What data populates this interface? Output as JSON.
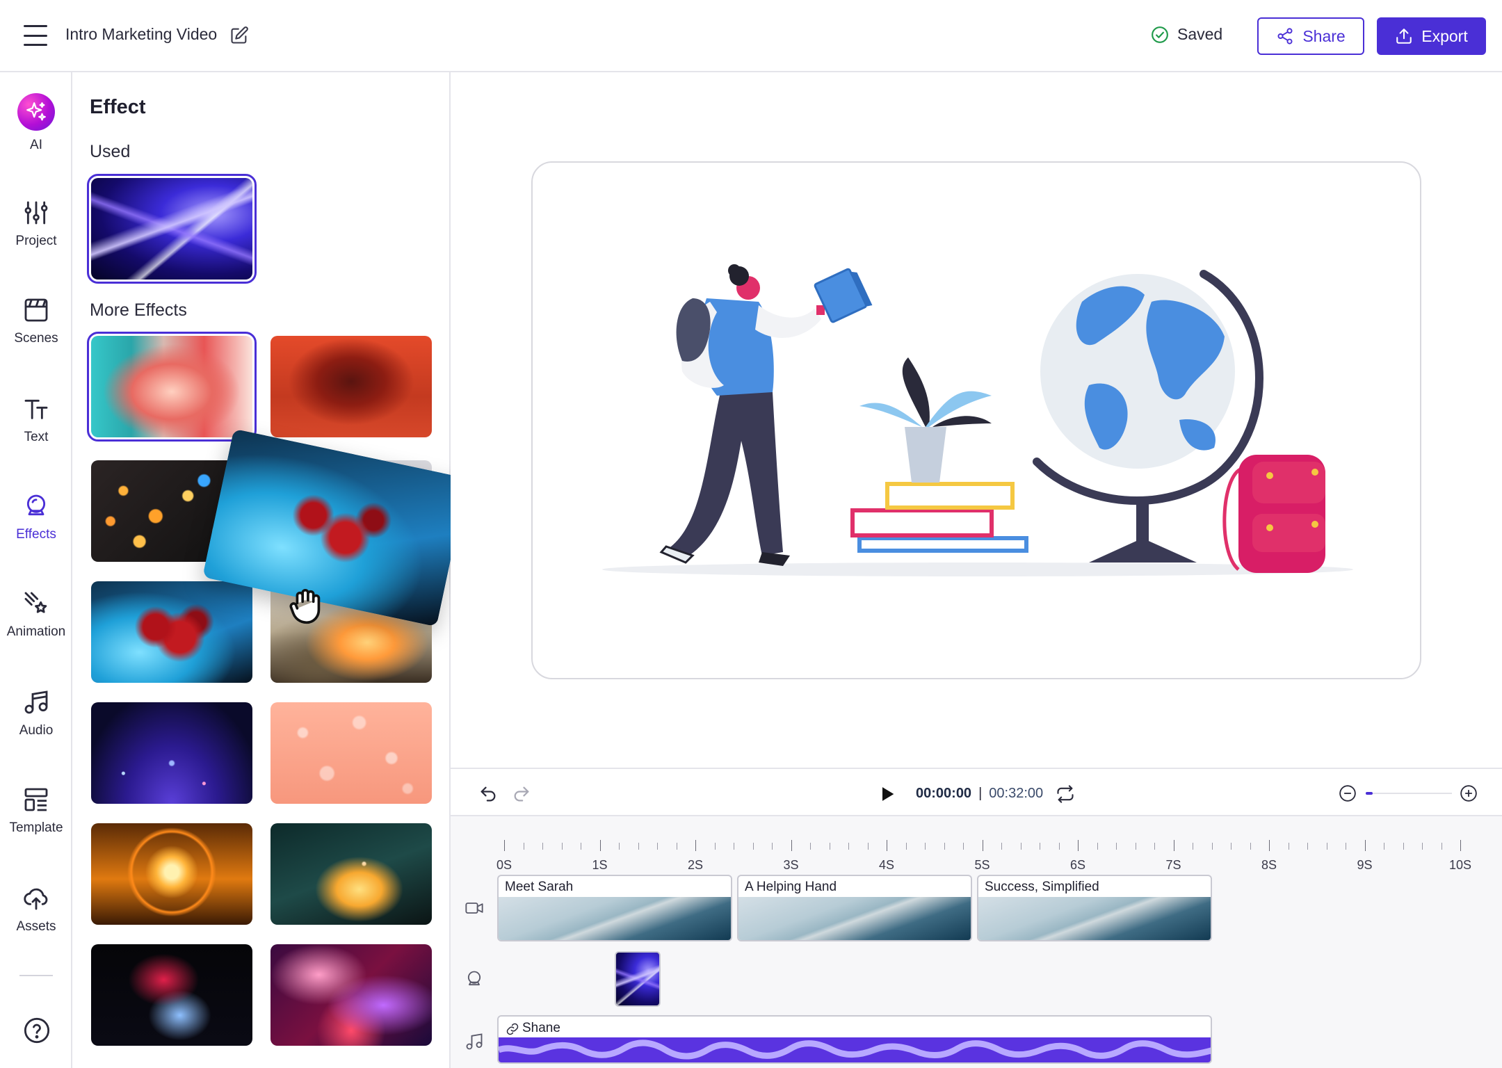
{
  "app": {
    "project_title": "Intro Marketing Video",
    "save_status": "Saved",
    "share_label": "Share",
    "export_label": "Export",
    "accent_color": "#4a2fd6"
  },
  "rail": {
    "items": [
      {
        "label": "AI",
        "icon": "ai-sparkle-icon"
      },
      {
        "label": "Project",
        "icon": "sliders-icon"
      },
      {
        "label": "Scenes",
        "icon": "clapperboard-icon"
      },
      {
        "label": "Text",
        "icon": "text-icon"
      },
      {
        "label": "Effects",
        "icon": "effects-icon",
        "active": true
      },
      {
        "label": "Animation",
        "icon": "animation-icon"
      },
      {
        "label": "Audio",
        "icon": "music-note-icon"
      },
      {
        "label": "Template",
        "icon": "template-icon"
      },
      {
        "label": "Assets",
        "icon": "cloud-upload-icon"
      }
    ],
    "help_icon": "help-icon"
  },
  "panel": {
    "title": "Effect",
    "used_label": "Used",
    "more_label": "More Effects"
  },
  "playback": {
    "current_time": "00:00:00",
    "separator": "|",
    "total_time": "00:32:00"
  },
  "timeline": {
    "ruler_labels": [
      "0S",
      "1S",
      "2S",
      "3S",
      "4S",
      "5S",
      "6S",
      "7S",
      "8S",
      "9S",
      "10S"
    ],
    "scenes": [
      {
        "label": "Meet Sarah"
      },
      {
        "label": "A Helping Hand"
      },
      {
        "label": "Success, Simplified"
      }
    ],
    "audio_label": "Shane"
  }
}
